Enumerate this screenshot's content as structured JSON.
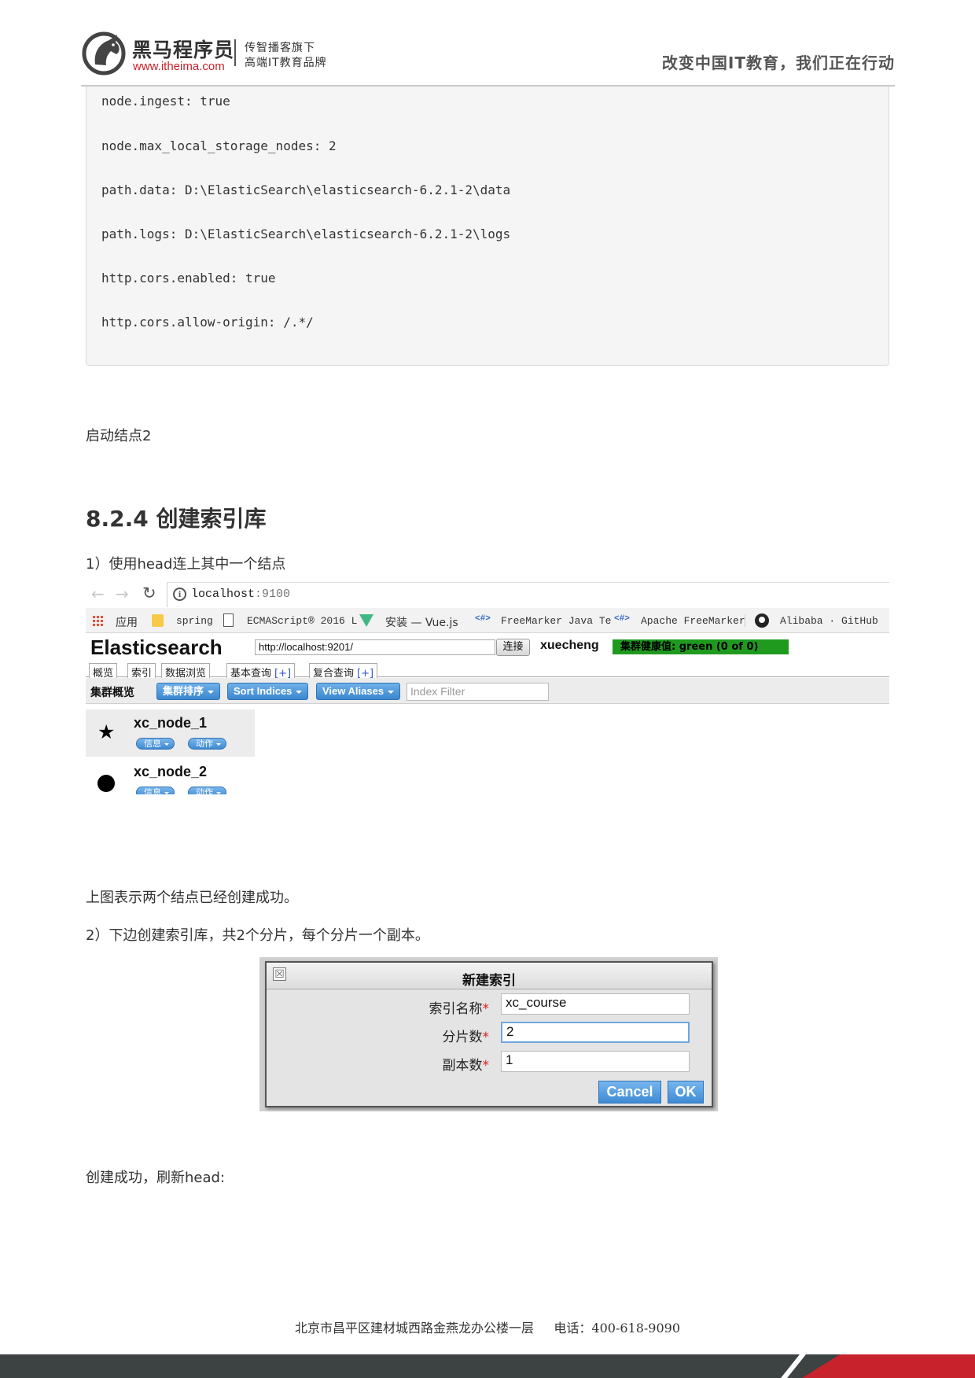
{
  "header": {
    "brand_name": "黑马程序员",
    "brand_url": "www.itheima.com",
    "tagline_1": "传智播客旗下",
    "tagline_2": "高端IT教育品牌",
    "slogan": "改变中国IT教育，我们正在行动"
  },
  "code_lines": [
    "node.ingest: true",
    "node.max_local_storage_nodes: 2",
    "path.data: D:\\ElasticSearch\\elasticsearch-6.2.1-2\\data",
    "path.logs: D:\\ElasticSearch\\elasticsearch-6.2.1-2\\logs",
    "http.cors.enabled: true",
    "http.cors.allow-origin: /.*/"
  ],
  "text": {
    "start_node": "启动结点2",
    "section_heading": "8.2.4 创建索引库",
    "step1": "1）使用head连上其中一个结点",
    "caption1": "上图表示两个结点已经创建成功。",
    "step2": "2）下边创建索引库，共2个分片，每个分片一个副本。",
    "caption2": "创建成功，刷新head:"
  },
  "browser": {
    "address_host": "localhost",
    "address_port": ":9100",
    "bookmarks": {
      "apps": "应用",
      "spring": "spring",
      "ecma": "ECMAScript® 2016 L",
      "vue": "安装 — Vue.js",
      "freemarker_java": "FreeMarker Java Te",
      "apache_freemarker": "Apache FreeMarker",
      "github": "Alibaba · GitHub"
    }
  },
  "es_head": {
    "title": "Elasticsearch",
    "connect_url": "http://localhost:9201/",
    "connect_label": "连接",
    "cluster_name": "xuecheng",
    "health": "集群健康值: green (0 of 0)",
    "health_color": "#1f9a1f",
    "tabs": [
      {
        "label": "概览",
        "plus": ""
      },
      {
        "label": "索引",
        "plus": ""
      },
      {
        "label": "数据浏览",
        "plus": ""
      },
      {
        "label": "基本查询",
        "plus": "[+]"
      },
      {
        "label": "复合查询",
        "plus": "[+]"
      }
    ],
    "toolbar_label": "集群概览",
    "toolbar_buttons": [
      "集群排序",
      "Sort Indices",
      "View Aliases"
    ],
    "index_filter_placeholder": "Index Filter",
    "nodes": [
      {
        "name": "xc_node_1",
        "icon": "star-icon",
        "info_label": "信息",
        "action_label": "动作"
      },
      {
        "name": "xc_node_2",
        "icon": "circle-icon",
        "info_label": "信息",
        "action_label": "动作"
      }
    ]
  },
  "dialog": {
    "title": "新建索引",
    "close_glyph": "☒",
    "fields": [
      {
        "label": "索引名称",
        "value": "xc_course"
      },
      {
        "label": "分片数",
        "value": "2"
      },
      {
        "label": "副本数",
        "value": "1"
      }
    ],
    "required_mark": "*",
    "cancel_label": "Cancel",
    "ok_label": "OK"
  },
  "footer": {
    "address": "北京市昌平区建材城西路金燕龙办公楼一层     电话：400-618-9090"
  }
}
